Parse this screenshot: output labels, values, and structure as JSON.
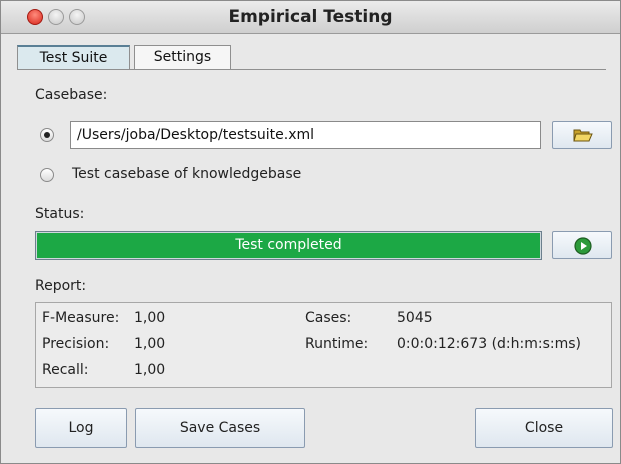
{
  "window": {
    "title": "Empirical Testing"
  },
  "tabs": [
    {
      "label": "Test Suite",
      "active": true
    },
    {
      "label": "Settings",
      "active": false
    }
  ],
  "casebase": {
    "label": "Casebase:",
    "file_option": {
      "selected": true,
      "value": "/Users/joba/Desktop/testsuite.xml"
    },
    "kb_option": {
      "selected": false,
      "label": "Test casebase of knowledgebase"
    },
    "browse_icon": "folder-open-icon"
  },
  "status": {
    "label": "Status:",
    "text": "Test completed",
    "progress": 1.0,
    "fill_color": "#1ca845",
    "run_icon": "play-icon"
  },
  "report": {
    "label": "Report:",
    "f_measure_label": "F-Measure:",
    "f_measure_value": "1,00",
    "precision_label": "Precision:",
    "precision_value": "1,00",
    "recall_label": "Recall:",
    "recall_value": "1,00",
    "cases_label": "Cases:",
    "cases_value": "5045",
    "runtime_label": "Runtime:",
    "runtime_value": "0:0:0:12:673 (d:h:m:s:ms)"
  },
  "buttons": {
    "log": "Log",
    "save_cases": "Save Cases",
    "close": "Close"
  }
}
